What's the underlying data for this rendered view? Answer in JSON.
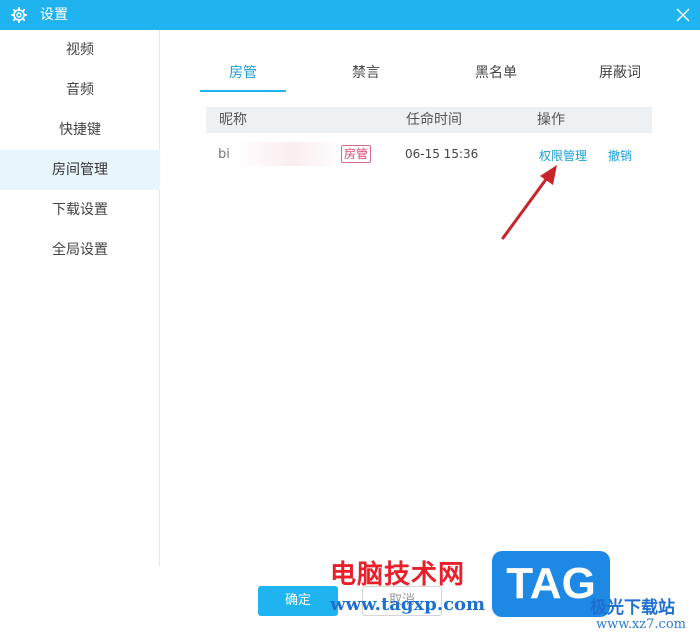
{
  "window": {
    "title": "设置",
    "accent_color": "#1fb4ef",
    "icon": "gear-icon",
    "close_icon": "close-icon"
  },
  "sidebar": {
    "items": [
      {
        "label": "视频"
      },
      {
        "label": "音频"
      },
      {
        "label": "快捷键"
      },
      {
        "label": "房间管理",
        "active": true
      },
      {
        "label": "下载设置"
      },
      {
        "label": "全局设置"
      }
    ]
  },
  "tabs": [
    {
      "label": "房管",
      "active": true
    },
    {
      "label": "禁言"
    },
    {
      "label": "黑名单"
    },
    {
      "label": "屏蔽词"
    }
  ],
  "table": {
    "headers": {
      "nickname": "昵称",
      "time": "任命时间",
      "actions": "操作"
    },
    "rows": [
      {
        "nickname": "bi",
        "badge": "房管",
        "time": "06-15 15:36",
        "action_permissions": "权限管理",
        "action_revoke": "撤销"
      }
    ]
  },
  "footer": {
    "ok_label": "确定",
    "cancel_label": "取消"
  },
  "watermark": {
    "cn_text": "电脑技术网",
    "url": "www.tagxp.com",
    "logo": "TAG",
    "site_text": "极光下载站",
    "site_url": "www.xz7.com"
  }
}
